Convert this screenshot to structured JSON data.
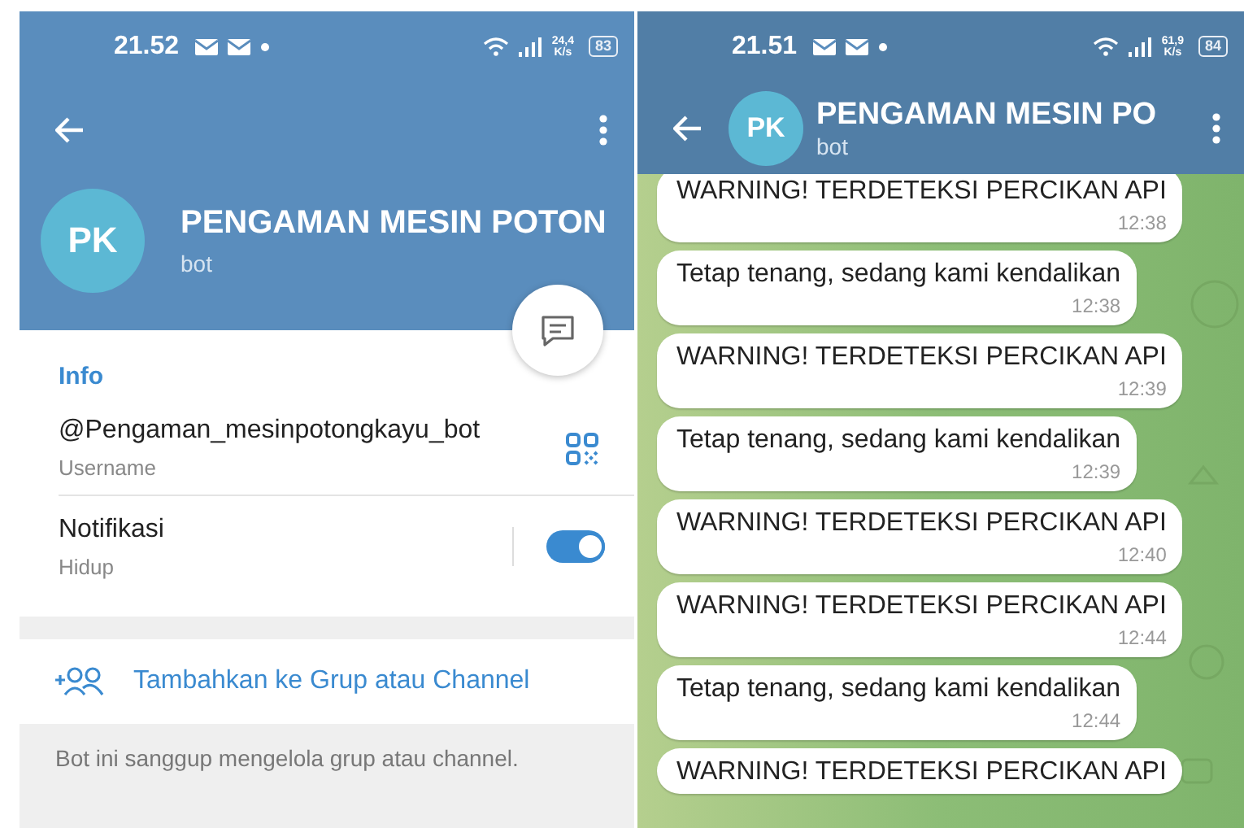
{
  "profile_screen": {
    "status_bar": {
      "time": "21.52",
      "net_speed": "24,4",
      "speed_unit": "K/s",
      "battery": "83"
    },
    "profile": {
      "avatar_initials": "PK",
      "name": "PENGAMAN MESIN POTON",
      "subtitle": "bot"
    },
    "info": {
      "heading": "Info",
      "username": "@Pengaman_mesinpotongkayu_bot",
      "username_label": "Username",
      "notifications_label": "Notifikasi",
      "notifications_value": "Hidup",
      "notifications_on": true
    },
    "add_action": "Tambahkan ke Grup atau Channel",
    "footer_note": "Bot ini sanggup mengelola grup atau channel."
  },
  "chat_screen": {
    "status_bar": {
      "time": "21.51",
      "net_speed": "61,9",
      "speed_unit": "K/s",
      "battery": "84"
    },
    "header": {
      "avatar_initials": "PK",
      "title": "PENGAMAN MESIN PO",
      "subtitle": "bot"
    },
    "messages": [
      {
        "text": "WARNING! TERDETEKSI PERCIKAN API",
        "time": "12:38"
      },
      {
        "text": "Tetap tenang, sedang kami kendalikan",
        "time": "12:38"
      },
      {
        "text": "WARNING! TERDETEKSI PERCIKAN API",
        "time": "12:39"
      },
      {
        "text": "Tetap tenang, sedang kami kendalikan",
        "time": "12:39"
      },
      {
        "text": "WARNING! TERDETEKSI PERCIKAN API",
        "time": "12:40"
      },
      {
        "text": "WARNING! TERDETEKSI PERCIKAN API",
        "time": "12:44"
      },
      {
        "text": "Tetap tenang, sedang kami kendalikan",
        "time": "12:44"
      },
      {
        "text": "WARNING! TERDETEKSI PERCIKAN API"
      }
    ]
  }
}
